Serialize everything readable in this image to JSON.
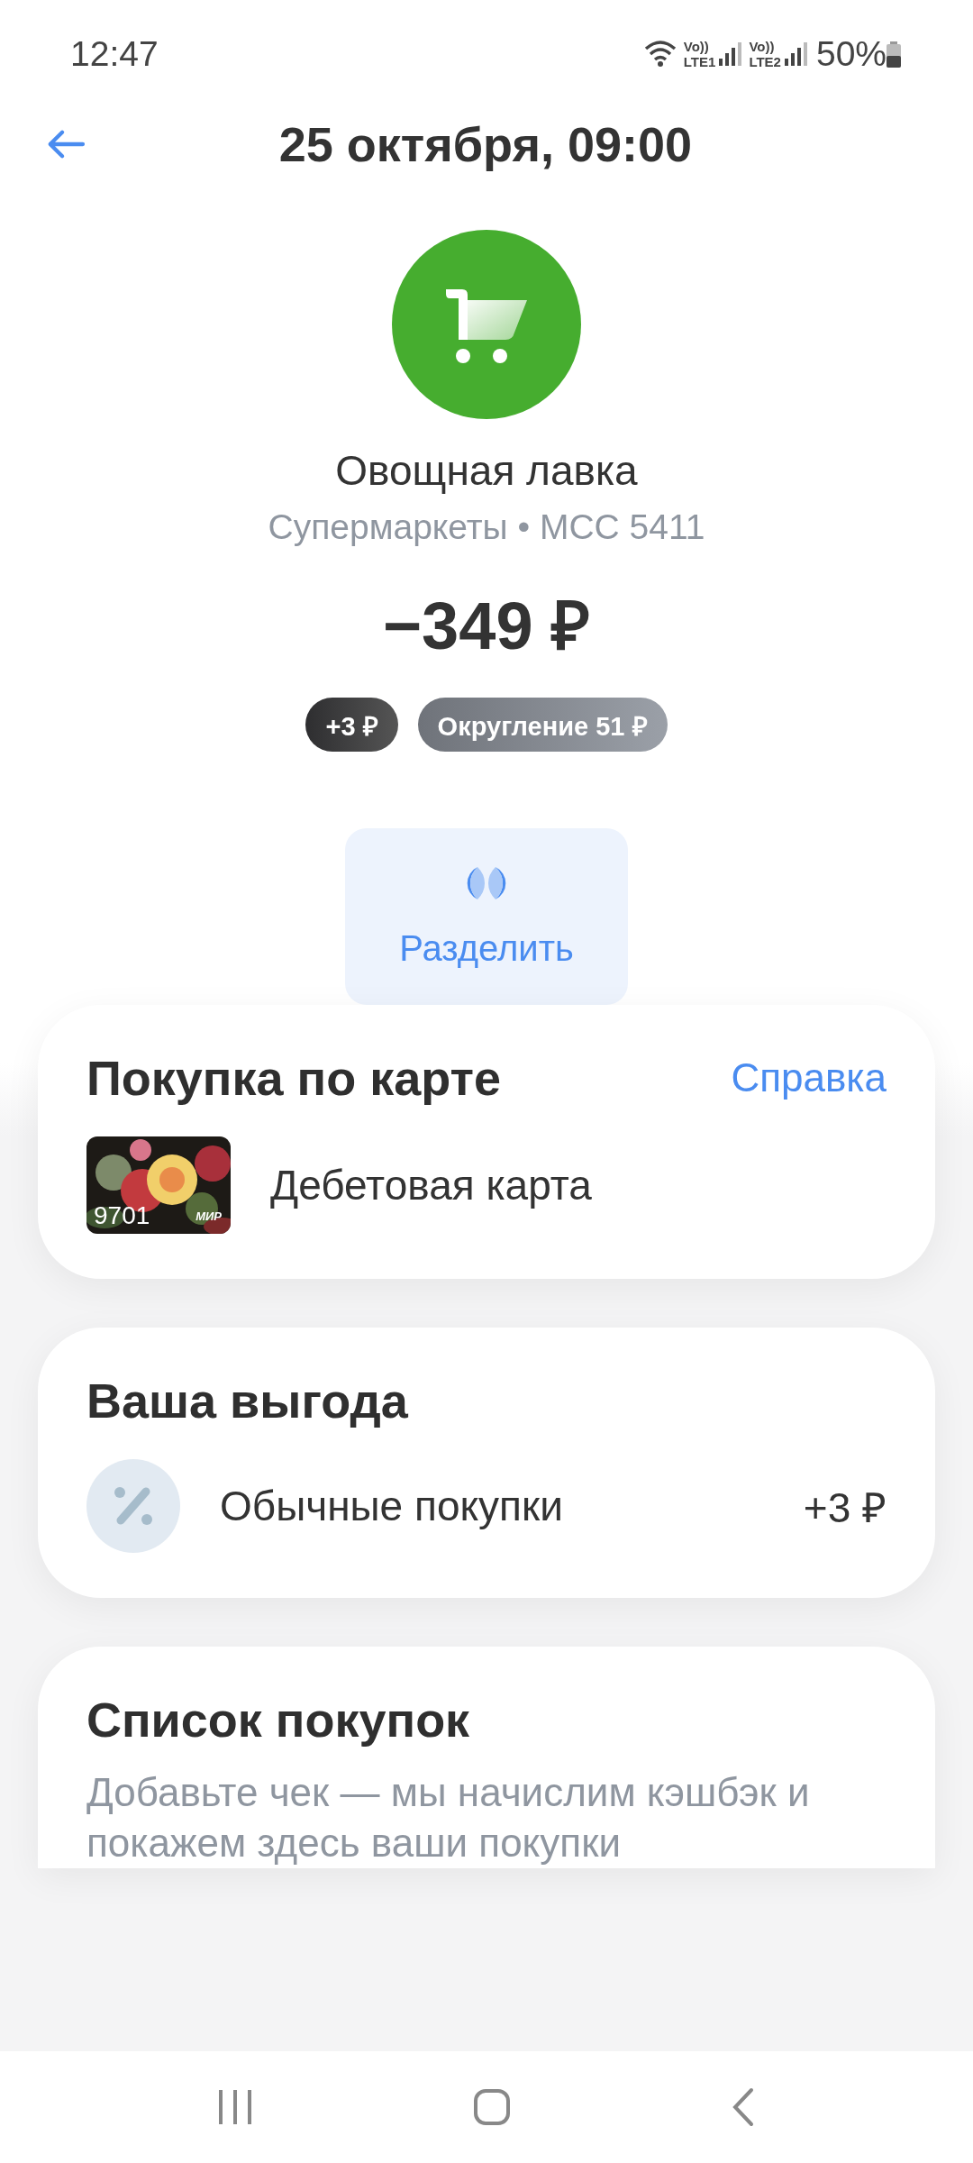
{
  "status_bar": {
    "time": "12:47",
    "networks": [
      {
        "voice": "Vo))",
        "label": "LTE1"
      },
      {
        "voice": "Vo))",
        "label": "LTE2"
      }
    ],
    "battery": "50%"
  },
  "header": {
    "title": "25 октября, 09:00"
  },
  "merchant": {
    "name": "Овощная лавка",
    "category": "Супермаркеты • MCC 5411",
    "amount": "−349 ₽"
  },
  "badges": [
    {
      "kind": "cashback",
      "text": "+3 ₽"
    },
    {
      "kind": "rounding",
      "text": "Округление 51 ₽"
    }
  ],
  "actions": [
    {
      "label": "Разделить"
    }
  ],
  "payment_card": {
    "title": "Покупка по карте",
    "link": "Справка",
    "card": {
      "name": "Дебетовая карта",
      "last_digits": "9701",
      "network": "МИР"
    }
  },
  "benefit": {
    "title": "Ваша выгода",
    "rows": [
      {
        "label": "Обычные покупки",
        "value": "+3 ₽"
      }
    ]
  },
  "purchases": {
    "title": "Список покупок",
    "text": "Добавьте чек — мы начислим кэшбэк и покажем здесь ваши покупки"
  }
}
